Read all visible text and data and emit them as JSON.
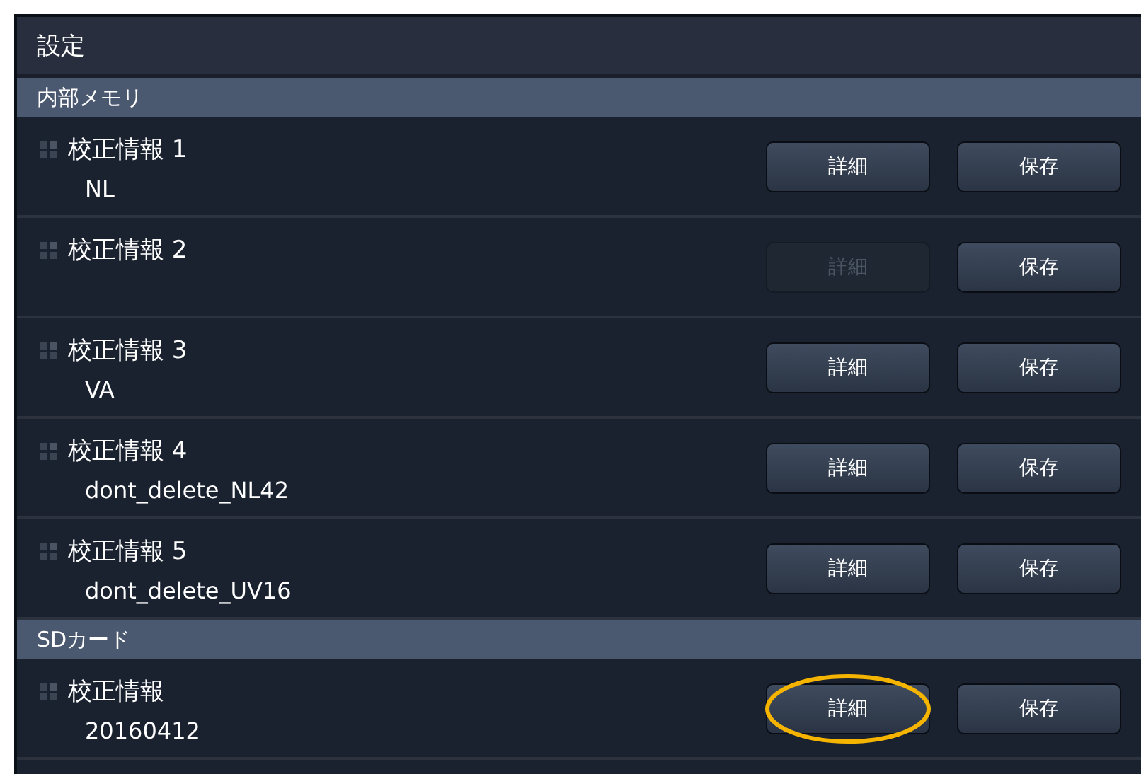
{
  "window": {
    "title": "設定"
  },
  "sections": [
    {
      "title": "内部メモリ",
      "items": [
        {
          "name": "校正情報 1",
          "value": "NL",
          "buttons": [
            {
              "label": "詳細",
              "disabled": false,
              "circled": false
            },
            {
              "label": "保存",
              "disabled": false,
              "circled": false
            }
          ]
        },
        {
          "name": "校正情報 2",
          "buttons": [
            {
              "label": "詳細",
              "disabled": true,
              "circled": false
            },
            {
              "label": "保存",
              "disabled": false,
              "circled": false
            }
          ]
        },
        {
          "name": "校正情報 3",
          "value": "VA",
          "buttons": [
            {
              "label": "詳細",
              "disabled": false,
              "circled": false
            },
            {
              "label": "保存",
              "disabled": false,
              "circled": false
            }
          ]
        },
        {
          "name": "校正情報 4",
          "value": "dont_delete_NL42",
          "buttons": [
            {
              "label": "詳細",
              "disabled": false,
              "circled": false
            },
            {
              "label": "保存",
              "disabled": false,
              "circled": false
            }
          ]
        },
        {
          "name": "校正情報 5",
          "value": "dont_delete_UV16",
          "buttons": [
            {
              "label": "詳細",
              "disabled": false,
              "circled": false
            },
            {
              "label": "保存",
              "disabled": false,
              "circled": false
            }
          ]
        }
      ]
    },
    {
      "title": "SDカード",
      "items": [
        {
          "name": "校正情報",
          "value": "20160412",
          "buttons": [
            {
              "label": "詳細",
              "disabled": false,
              "circled": true
            },
            {
              "label": "保存",
              "disabled": false,
              "circled": false
            }
          ]
        }
      ]
    }
  ]
}
